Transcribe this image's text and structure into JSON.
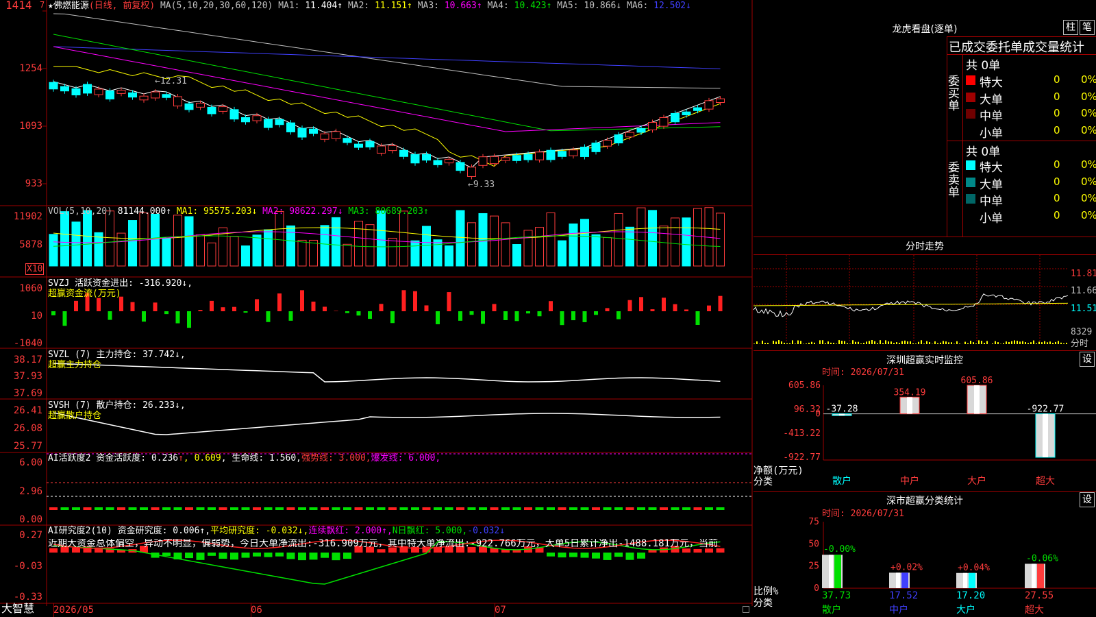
{
  "left": {
    "stock": "佛燃能源",
    "period": "(日线, 前复权)",
    "ma_header": "MA(5,10,20,30,60,120)",
    "ma": [
      {
        "label": "MA1:",
        "value": "11.404↑",
        "color": "#ffffff"
      },
      {
        "label": "MA2:",
        "value": "11.151↑",
        "color": "#ffff00"
      },
      {
        "label": "MA3:",
        "value": "10.663↑",
        "color": "#ff00ff"
      },
      {
        "label": "MA4:",
        "value": "10.423↑",
        "color": "#00e000"
      },
      {
        "label": "MA5:",
        "value": "10.866↓",
        "color": "#c0c0c0"
      },
      {
        "label": "MA6:",
        "value": "12.502↓",
        "color": "#4040ff"
      }
    ],
    "price_axis": [
      "1414",
      "1254",
      "1093",
      "933"
    ],
    "high_marker": "←12.31",
    "low_marker": "←9.33",
    "vol": {
      "header": "VOL(5,10,20)",
      "value": "81144.000↑",
      "ma": [
        {
          "label": "MA1:",
          "value": "95575.203↓",
          "color": "#ffff00"
        },
        {
          "label": "MA2:",
          "value": "98622.297↓",
          "color": "#ff00ff"
        },
        {
          "label": "MA3:",
          "value": "80689.203↑",
          "color": "#00e000"
        }
      ],
      "axis": [
        "11902",
        "5878"
      ],
      "unit": "X10"
    },
    "svzj": {
      "line1": "SVZJ  活跃资金进出: -316.920↓,",
      "line2": "超赢资金流(万元)",
      "axis": [
        "1060",
        "10",
        "-1040"
      ]
    },
    "svzl": {
      "line1": "SVZL (7) 主力持仓: 37.742↓,",
      "line2": "超赢主力持仓",
      "axis": [
        "38.17",
        "37.93",
        "37.69"
      ]
    },
    "svsh": {
      "line1": "SVSH (7) 散户持仓: 26.233↓,",
      "line2": "超赢散户持仓",
      "axis": [
        "26.41",
        "26.08",
        "25.77"
      ]
    },
    "ai1": {
      "a": "AI活跃度2 资金活跃度: 0.236",
      "a_arrow": "↑",
      "b": ", 0.609",
      "c": ", 生命线: 1.560,",
      "d": "强势线: 3.000,",
      "e": "爆发线: 6.000,",
      "axis": [
        "6.00",
        "2.96",
        "0.00"
      ]
    },
    "ai2": {
      "a": "AI研究度2(10) 资金研究度: 0.006↑,",
      "b": "平均研究度: -0.032↓,",
      "c": "连续飘红: 2.000↑,",
      "d": "N日飘红: 5.000,",
      "e": "-0.032↓",
      "comment": "近期大资金总体偏空，异动不明显，偏弱势，今日大单净流出:-316.909万元，其中特大单净流出:-922.766万元，大单5日累计净出-1488.181万元，当前",
      "axis": [
        "0.27",
        "-0.03",
        "-0.33"
      ]
    },
    "dates": [
      "2026/05",
      "06",
      "07"
    ],
    "brand": "大智慧",
    "top_num": "7"
  },
  "right": {
    "lhb_title": "龙虎看盘(逐单)",
    "btn_zhu": "柱",
    "btn_bi": "笔",
    "stat_title": "已成交委托单成交量统计",
    "buy_label": "委买单",
    "sell_label": "委卖单",
    "buy_total": "共 0单",
    "sell_total": "共 0单",
    "buy_rows": [
      {
        "name": "特大",
        "count": "0",
        "pct": "0%",
        "color": "#ff0000"
      },
      {
        "name": "大单",
        "count": "0",
        "pct": "0%",
        "color": "#a00000"
      },
      {
        "name": "中单",
        "count": "0",
        "pct": "0%",
        "color": "#700000"
      },
      {
        "name": "小单",
        "count": "0",
        "pct": "0%",
        "color": ""
      }
    ],
    "sell_rows": [
      {
        "name": "特大",
        "count": "0",
        "pct": "0%",
        "color": "#00ffff"
      },
      {
        "name": "大单",
        "count": "0",
        "pct": "0%",
        "color": "#008888"
      },
      {
        "name": "中单",
        "count": "0",
        "pct": "0%",
        "color": "#006666"
      },
      {
        "name": "小单",
        "count": "0",
        "pct": "0%",
        "color": ""
      }
    ],
    "fs_title": "分时走势",
    "fs_axis": [
      "11.81",
      "11.66",
      "11.51",
      "8329",
      "分时"
    ],
    "monitor": {
      "title": "深圳超赢实时监控",
      "set": "设",
      "time": "时间: 2026/07/31",
      "axis": [
        "605.86",
        "96.32",
        "0",
        "-413.22",
        "-922.77"
      ],
      "y_caption1": "净额(万元)",
      "y_caption2": "分类"
    },
    "classify": {
      "title": "深市超赢分类统计",
      "set": "设",
      "time": "时间: 2026/07/31",
      "axis": [
        "75",
        "50",
        "25",
        "0"
      ],
      "y_caption1": "比例%",
      "y_caption2": "分类",
      "vals": [
        "37.73",
        "17.52",
        "17.20",
        "27.55"
      ]
    }
  },
  "chart_data": [
    {
      "type": "bar",
      "title": "深圳超赢实时监控",
      "ylabel": "净额(万元)",
      "categories": [
        "散户",
        "中户",
        "大户",
        "超大"
      ],
      "values": [
        -37.28,
        354.19,
        605.86,
        -922.77
      ],
      "labels": [
        "-37.28",
        "354.19",
        "605.86",
        "-922.77"
      ],
      "ylim": [
        -922.77,
        605.86
      ]
    },
    {
      "type": "bar",
      "title": "深市超赢分类统计",
      "ylabel": "比例%",
      "categories": [
        "散户",
        "中户",
        "大户",
        "超大"
      ],
      "values": [
        37.73,
        17.52,
        17.2,
        27.55
      ],
      "change_labels": [
        "-0.00%",
        "+0.02%",
        "+0.04%",
        "-0.06%"
      ],
      "ylim": [
        0,
        75
      ]
    }
  ]
}
